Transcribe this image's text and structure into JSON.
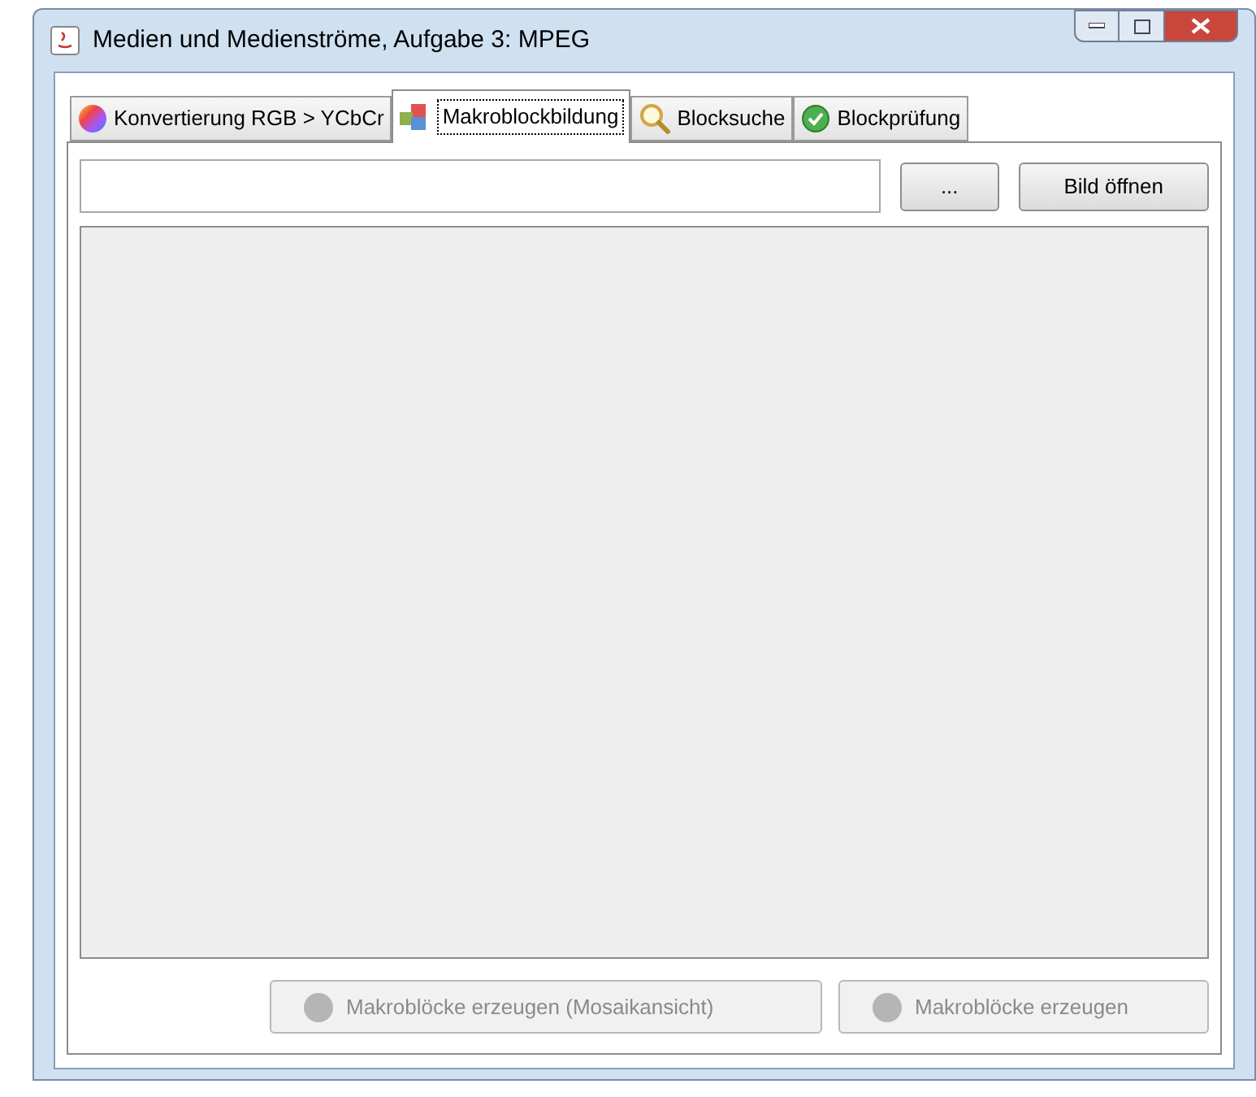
{
  "window": {
    "title": "Medien und Medienströme, Aufgabe 3: MPEG"
  },
  "tabs": [
    {
      "label": "Konvertierung RGB > YCbCr",
      "selected": false
    },
    {
      "label": "Makroblockbildung",
      "selected": true
    },
    {
      "label": "Blocksuche",
      "selected": false
    },
    {
      "label": "Blockprüfung",
      "selected": false
    }
  ],
  "toolbar": {
    "browse_button": "...",
    "open_button": "Bild öffnen"
  },
  "actions": [
    {
      "label": "Makroblöcke erzeugen (Mosaikansicht)",
      "disabled": true
    },
    {
      "label": "Makroblöcke erzeugen",
      "disabled": true
    }
  ]
}
